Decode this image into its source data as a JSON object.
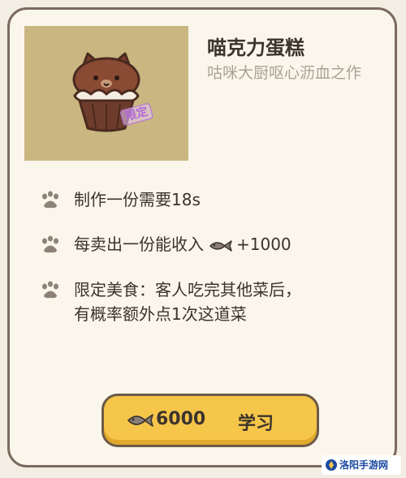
{
  "item": {
    "name": "喵克力蛋糕",
    "description": "咕咪大厨呕心沥血之作",
    "image_badge": "限定"
  },
  "details": [
    {
      "icon": "paw-icon",
      "text": "制作一份需要18s"
    },
    {
      "icon": "paw-icon",
      "prefix": "每卖出一份能收入",
      "suffix": "+1000"
    },
    {
      "icon": "paw-icon",
      "line1": "限定美食：客人吃完其他菜后，",
      "line2": "有概率额外点1次这道菜"
    }
  ],
  "learn_button": {
    "price": "6000",
    "label": "学习"
  },
  "watermark": "洛阳手游网",
  "colors": {
    "accent": "#f6c64a",
    "border": "#7a6a5e",
    "image_bg": "#c9b680"
  }
}
